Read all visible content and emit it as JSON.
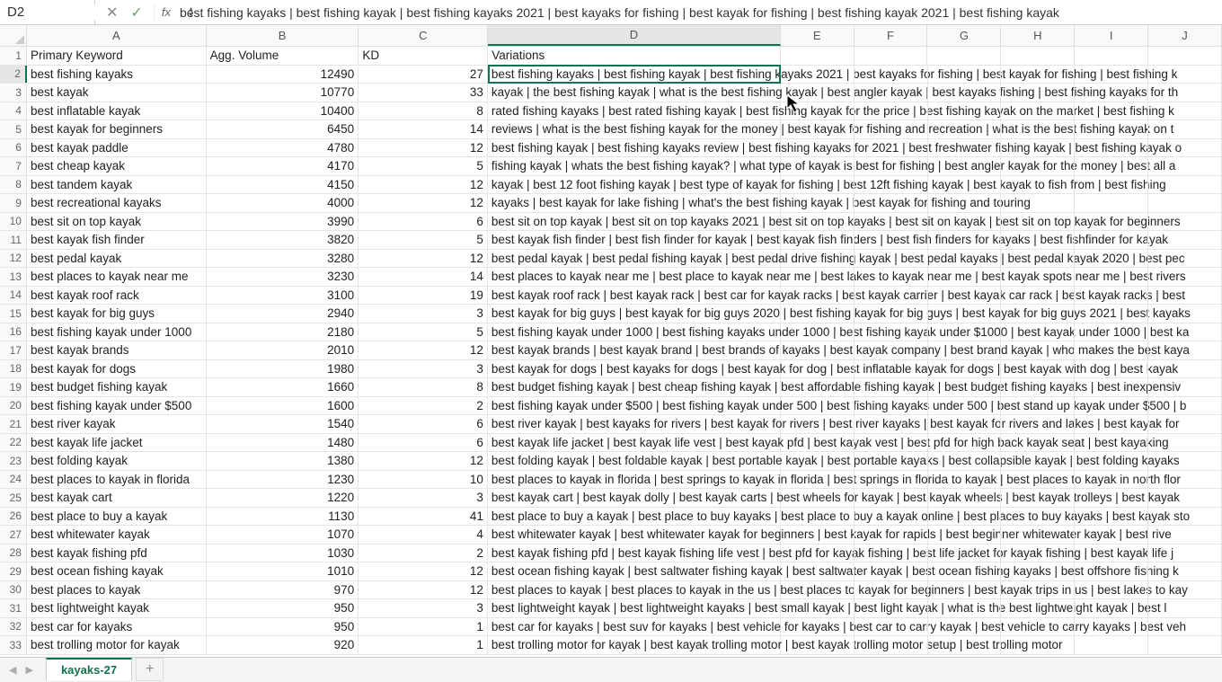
{
  "cellRef": "D2",
  "formula": "best fishing kayaks | best fishing kayak | best fishing kayaks 2021 | best kayaks for fishing | best kayak for fishing | best fishing kayak 2021 | best fishing kayak",
  "sheetTab": "kayaks-27",
  "columns": [
    "A",
    "B",
    "C",
    "D",
    "E",
    "F",
    "G",
    "H",
    "I",
    "J"
  ],
  "selectedCol": "D",
  "selectedRow": 2,
  "headers": {
    "A": "Primary Keyword",
    "B": "Agg. Volume",
    "C": "KD",
    "D": "Variations"
  },
  "rows": [
    {
      "a": "best fishing kayaks",
      "b": "12490",
      "c": "27",
      "d": "best fishing kayaks | best fishing kayak | best fishing kayaks 2021 | best kayaks for fishing | best kayak for fishing | best fishing k"
    },
    {
      "a": "best kayak",
      "b": "10770",
      "c": "33",
      "d": "kayak | the best fishing kayak | what is the best fishing kayak | best angler kayak | best kayaks fishing | best fishing kayaks for th"
    },
    {
      "a": "best inflatable kayak",
      "b": "10400",
      "c": "8",
      "d": "rated fishing kayaks | best rated fishing kayak | best fishing kayak for the price | best fishing kayak on the market | best fishing k"
    },
    {
      "a": "best kayak for beginners",
      "b": "6450",
      "c": "14",
      "d": "reviews | what is the best fishing kayak for the money | best kayak for fishing and recreation | what is the best fishing kayak on t"
    },
    {
      "a": "best kayak paddle",
      "b": "4780",
      "c": "12",
      "d": "best fishing kayak | best fishing kayaks review | best fishing kayaks for 2021 | best freshwater fishing kayak | best fishing kayak o"
    },
    {
      "a": "best cheap kayak",
      "b": "4170",
      "c": "5",
      "d": "fishing kayak | whats the best fishing kayak? | what type of kayak is best for fishing | best angler kayak for the money | best all a"
    },
    {
      "a": "best tandem kayak",
      "b": "4150",
      "c": "12",
      "d": "kayak | best 12 foot fishing kayak | best type of kayak for fishing | best 12ft fishing kayak | best kayak to fish from | best fishing"
    },
    {
      "a": "best recreational kayaks",
      "b": "4000",
      "c": "12",
      "d": "kayaks | best kayak for lake fishing | what's the best fishing kayak | best kayak for fishing and touring"
    },
    {
      "a": "best sit on top kayak",
      "b": "3990",
      "c": "6",
      "d": "best sit on top kayak | best sit on top kayaks 2021 | best sit on top kayaks | best sit on kayak | best sit on top kayak for beginners"
    },
    {
      "a": "best kayak fish finder",
      "b": "3820",
      "c": "5",
      "d": "best kayak fish finder | best fish finder for kayak | best kayak fish finders | best fish finders for kayaks | best fishfinder for kayak"
    },
    {
      "a": "best pedal kayak",
      "b": "3280",
      "c": "12",
      "d": "best pedal kayak | best pedal fishing kayak | best pedal drive fishing kayak | best pedal kayaks | best pedal kayak 2020 | best pec"
    },
    {
      "a": "best places to kayak near me",
      "b": "3230",
      "c": "14",
      "d": "best places to kayak near me | best place to kayak near me | best lakes to kayak near me | best kayak spots near me | best rivers"
    },
    {
      "a": "best kayak roof rack",
      "b": "3100",
      "c": "19",
      "d": "best kayak roof rack | best kayak rack | best car for kayak racks | best kayak carrier | best kayak car rack | best kayak racks | best"
    },
    {
      "a": "best kayak for big guys",
      "b": "2940",
      "c": "3",
      "d": "best kayak for big guys | best kayak for big guys 2020 | best fishing kayak for big guys | best kayak for big guys 2021 | best kayaks"
    },
    {
      "a": "best fishing kayak under 1000",
      "b": "2180",
      "c": "5",
      "d": "best fishing kayak under 1000 | best fishing kayaks under 1000 | best fishing kayak under $1000 | best kayak under 1000 | best ka"
    },
    {
      "a": "best kayak brands",
      "b": "2010",
      "c": "12",
      "d": "best kayak brands | best kayak brand | best brands of kayaks | best kayak company | best brand kayak | who makes the best kaya"
    },
    {
      "a": "best kayak for dogs",
      "b": "1980",
      "c": "3",
      "d": "best kayak for dogs | best kayaks for dogs | best kayak for dog | best inflatable kayak for dogs | best kayak with dog | best kayak"
    },
    {
      "a": "best budget fishing kayak",
      "b": "1660",
      "c": "8",
      "d": "best budget fishing kayak | best cheap fishing kayak | best affordable fishing kayak | best budget fishing kayaks | best inexpensiv"
    },
    {
      "a": "best fishing kayak under $500",
      "b": "1600",
      "c": "2",
      "d": "best fishing kayak under $500 | best fishing kayak under 500 | best fishing kayaks under 500 | best stand up kayak under $500 | b"
    },
    {
      "a": "best river kayak",
      "b": "1540",
      "c": "6",
      "d": "best river kayak | best kayaks for rivers | best kayak for rivers | best river kayaks | best kayak for rivers and lakes | best kayak for"
    },
    {
      "a": "best kayak life jacket",
      "b": "1480",
      "c": "6",
      "d": "best kayak life jacket | best kayak life vest | best kayak pfd | best kayak vest | best pfd for high back kayak seat | best kayaking"
    },
    {
      "a": "best folding kayak",
      "b": "1380",
      "c": "12",
      "d": "best folding kayak | best foldable kayak | best portable kayak | best portable kayaks | best collapsible kayak | best folding kayaks"
    },
    {
      "a": "best places to kayak in florida",
      "b": "1230",
      "c": "10",
      "d": "best places to kayak in florida | best springs to kayak in florida | best springs in florida to kayak | best places to kayak in north flor"
    },
    {
      "a": "best kayak cart",
      "b": "1220",
      "c": "3",
      "d": "best kayak cart | best kayak dolly | best kayak carts | best wheels for kayak | best kayak wheels | best kayak trolleys | best kayak"
    },
    {
      "a": "best place to buy a kayak",
      "b": "1130",
      "c": "41",
      "d": "best place to buy a kayak | best place to buy kayaks | best place to buy a kayak online | best places to buy kayaks | best kayak sto"
    },
    {
      "a": "best whitewater kayak",
      "b": "1070",
      "c": "4",
      "d": "best whitewater kayak | best whitewater kayak for beginners | best kayak for rapids | best beginner whitewater kayak | best rive"
    },
    {
      "a": "best kayak fishing pfd",
      "b": "1030",
      "c": "2",
      "d": "best kayak fishing pfd | best kayak fishing life vest | best pfd for kayak fishing | best life jacket for kayak fishing | best kayak life j"
    },
    {
      "a": "best ocean fishing kayak",
      "b": "1010",
      "c": "12",
      "d": "best ocean fishing kayak | best saltwater fishing kayak | best saltwater kayak | best ocean fishing kayaks | best offshore fishing k"
    },
    {
      "a": "best places to kayak",
      "b": "970",
      "c": "12",
      "d": "best places to kayak | best places to kayak in the us | best places to kayak for beginners | best kayak trips in us | best lakes to kay"
    },
    {
      "a": "best lightweight kayak",
      "b": "950",
      "c": "3",
      "d": "best lightweight kayak | best lightweight kayaks | best small kayak | best light kayak | what is the best lightweight kayak | best l"
    },
    {
      "a": "best car for kayaks",
      "b": "950",
      "c": "1",
      "d": "best car for kayaks | best suv for kayaks | best vehicle for kayaks | best car to carry kayak | best vehicle to carry kayaks | best veh"
    },
    {
      "a": "best trolling motor for kayak",
      "b": "920",
      "c": "1",
      "d": "best trolling motor for kayak | best kayak trolling motor | best kayak trolling motor setup | best trolling motor"
    }
  ]
}
